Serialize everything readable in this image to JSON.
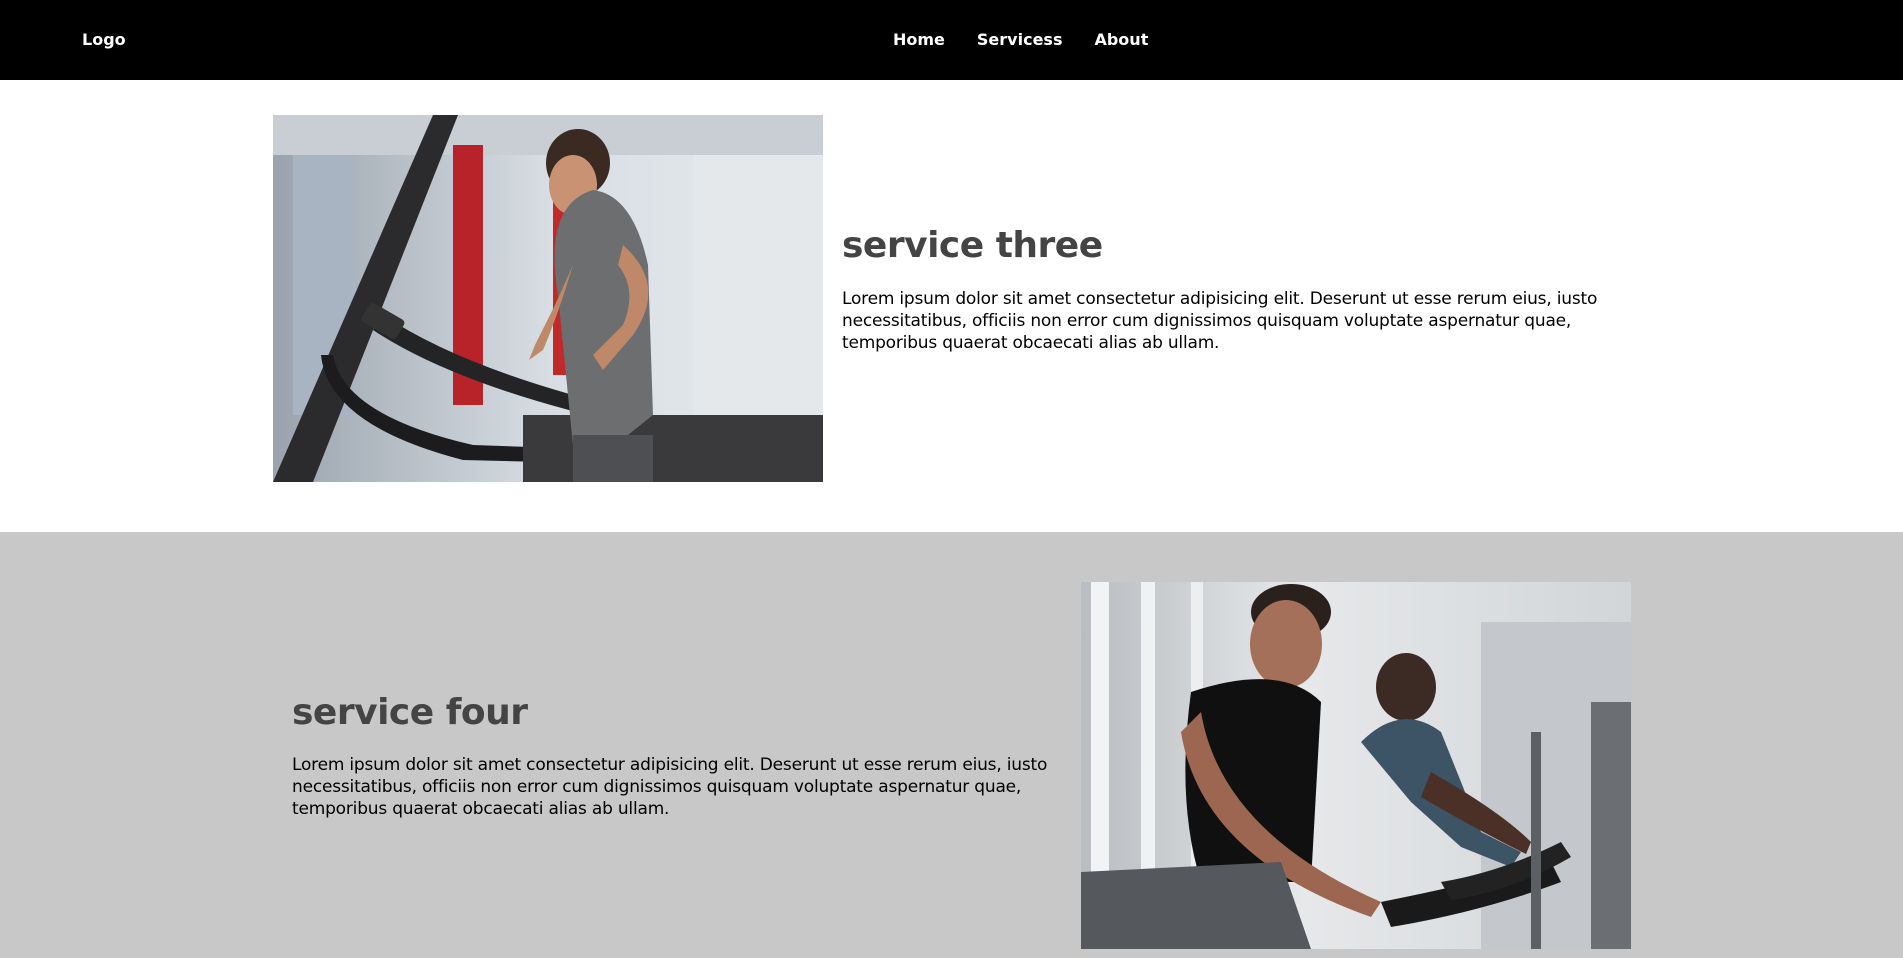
{
  "navbar": {
    "logo": "Logo",
    "links": [
      {
        "label": "Home"
      },
      {
        "label": "Servicess"
      },
      {
        "label": "About"
      }
    ]
  },
  "services": [
    {
      "title": "service three",
      "text": "Lorem ipsum dolor sit amet consectetur adipisicing elit. Deserunt ut esse rerum eius, iusto necessitatibus, officiis non error cum dignissimos quisquam voluptate aspernatur quae, temporibus quaerat obcaecati alias ab ullam.",
      "image_icon": "treadmill-photo"
    },
    {
      "title": "service four",
      "text": "Lorem ipsum dolor sit amet consectetur adipisicing elit. Deserunt ut esse rerum eius, iusto necessitatibus, officiis non error cum dignissimos quisquam voluptate aspernatur quae, temporibus quaerat obcaecati alias ab ullam.",
      "image_icon": "exercise-bike-photo"
    }
  ],
  "colors": {
    "navbar_bg": "#000000",
    "section_alt_bg": "#c8c8c8",
    "title_color": "#444444"
  }
}
